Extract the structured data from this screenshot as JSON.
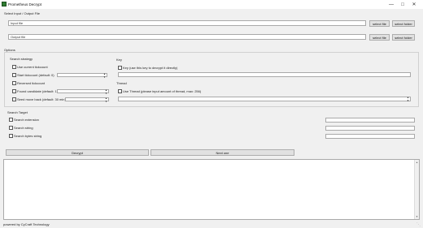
{
  "window": {
    "title": "Prometheus Decrypt",
    "minimize_icon": "minimize-icon",
    "maximize_icon": "maximize-icon",
    "close_icon": "close-icon"
  },
  "io_section": {
    "heading": "Select Input / Output File",
    "input_placeholder": "Input file",
    "output_placeholder": "Output file",
    "select_file_label": "select file",
    "select_folder_label": "select folder"
  },
  "options": {
    "heading": "Options",
    "search_strategy": {
      "heading": "Search strategy",
      "items": [
        {
          "label": "Use current tickcount"
        },
        {
          "label": "Start tickcount (default: 0)"
        },
        {
          "label": "Reversed tickcount"
        },
        {
          "label": "Found candidate (default: 1)"
        },
        {
          "label": "Seed move back (default: 30 min)"
        }
      ]
    },
    "key": {
      "heading": "Key",
      "checkbox_label": "Key (use this key to decrypt it directly)"
    },
    "thread": {
      "heading": "Thread",
      "checkbox_label": "Use Thread (please input amount of thread, max: 256)"
    }
  },
  "search_target": {
    "heading": "Search Target",
    "items": [
      {
        "label": "Search extension"
      },
      {
        "label": "Search string"
      },
      {
        "label": "Search bytes string"
      }
    ]
  },
  "actions": {
    "decrypt_label": "Decrypt",
    "next_label": "Next one"
  },
  "footer": {
    "text": "powered by CyCraft Technology"
  },
  "colors": {
    "window_bg": "#f0f0f0",
    "button_bg": "#e1e1e1",
    "field_border": "#a9a9a9",
    "icon_green": "#2f7d32"
  }
}
